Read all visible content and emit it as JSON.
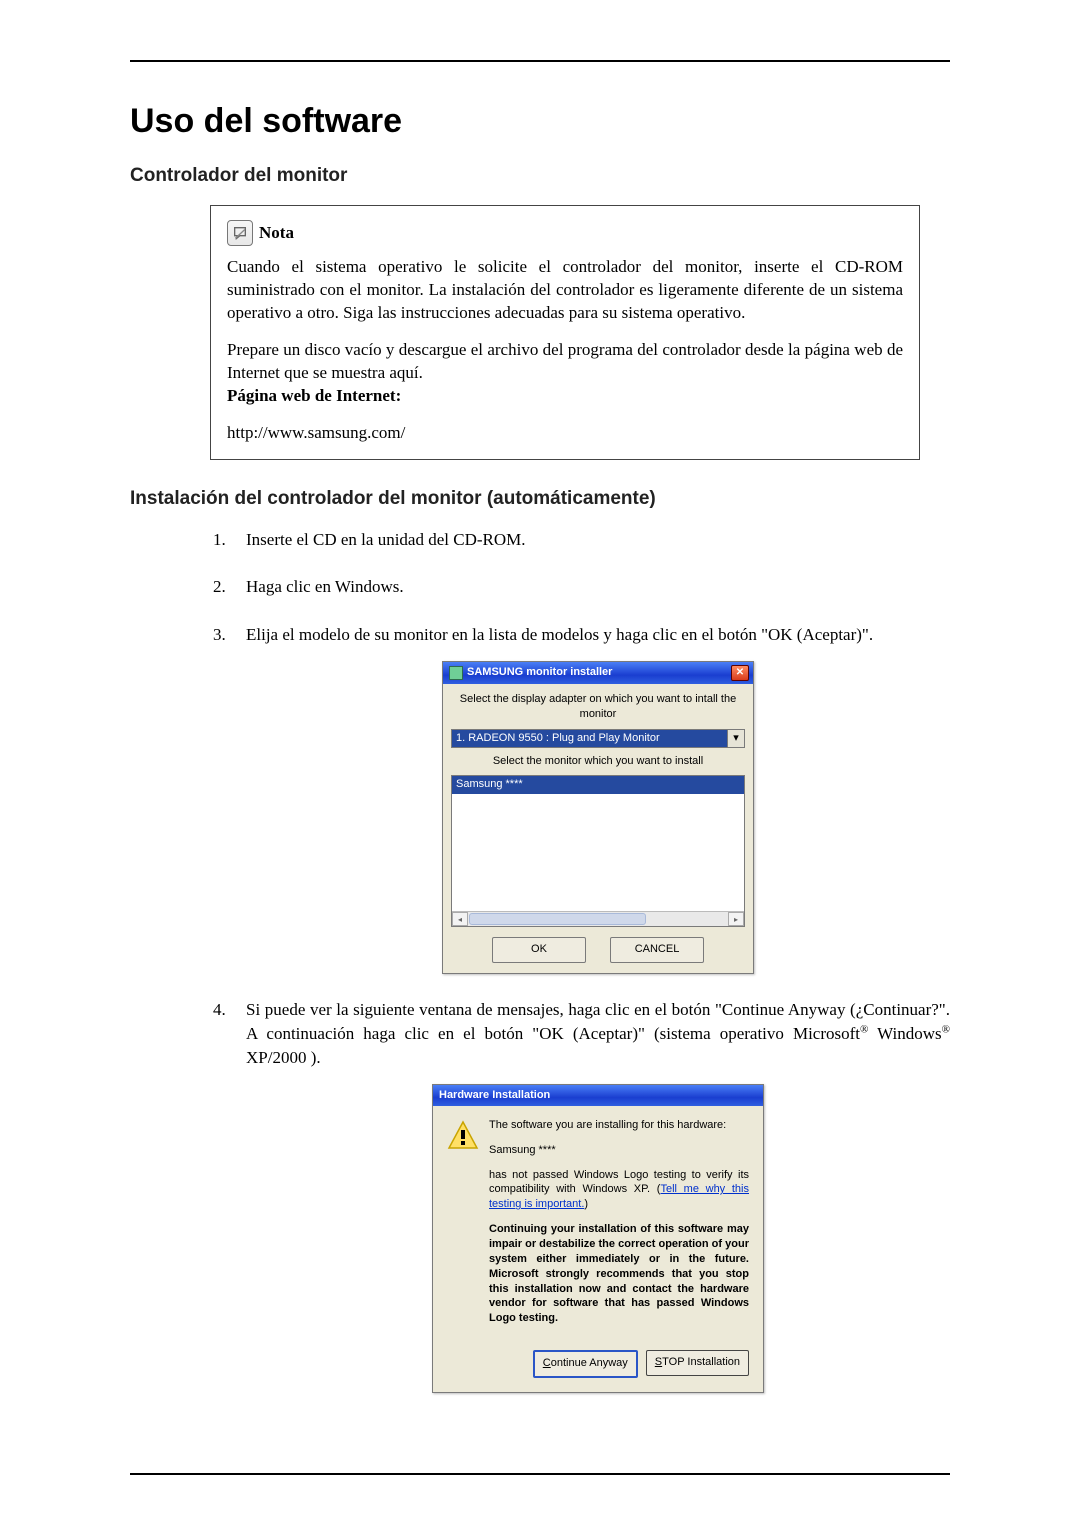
{
  "page_title": "Uso del software",
  "section1_title": "Controlador del monitor",
  "note": {
    "label": "Nota",
    "p1": "Cuando el sistema operativo le solicite el controlador del monitor, inserte el CD-ROM suministrado con el monitor. La instalación del controlador es ligeramente diferente de un sistema operativo a otro. Siga las instrucciones adecuadas para su sistema operativo.",
    "p2": "Prepare un disco vacío y descargue el archivo del programa del controlador desde la página web de Internet que se muestra aquí.",
    "p3_label": "Página web de Internet:",
    "url": "http://www.samsung.com/"
  },
  "section2_title": "Instalación del controlador del monitor (automáticamente)",
  "steps": {
    "s1": "Inserte el CD en la unidad del CD-ROM.",
    "s2": "Haga clic en Windows.",
    "s3": "Elija el modelo de su monitor en la lista de modelos y haga clic en el botón \"OK (Aceptar)\".",
    "s4_a": "Si puede ver la siguiente ventana de mensajes, haga clic en el botón \"Continue Anyway (¿Continuar?\". A continuación haga clic en el botón \"OK (Aceptar)\" (sistema operativo Microsoft",
    "s4_b": " Windows",
    "s4_c": " XP/2000 )."
  },
  "installer": {
    "title": "SAMSUNG monitor installer",
    "lbl1": "Select the display adapter on which you want to intall the monitor",
    "adapter": "1. RADEON 9550 : Plug and Play Monitor",
    "lbl2": "Select the monitor which you want to install",
    "selected": "Samsung ****",
    "ok": "OK",
    "cancel": "CANCEL"
  },
  "hw": {
    "title": "Hardware Installation",
    "line1": "The software you are installing for this hardware:",
    "line2": "Samsung ****",
    "line3a": "has not passed Windows Logo testing to verify its compatibility with Windows XP. (",
    "link": "Tell me why this testing is important.",
    "line3b": ")",
    "warn": "Continuing your installation of this software may impair or destabilize the correct operation of your system either immediately or in the future. Microsoft strongly recommends that you stop this installation now and contact the hardware vendor for software that has passed Windows Logo testing.",
    "btn_continue": "Continue Anyway",
    "btn_stop": "STOP Installation"
  }
}
